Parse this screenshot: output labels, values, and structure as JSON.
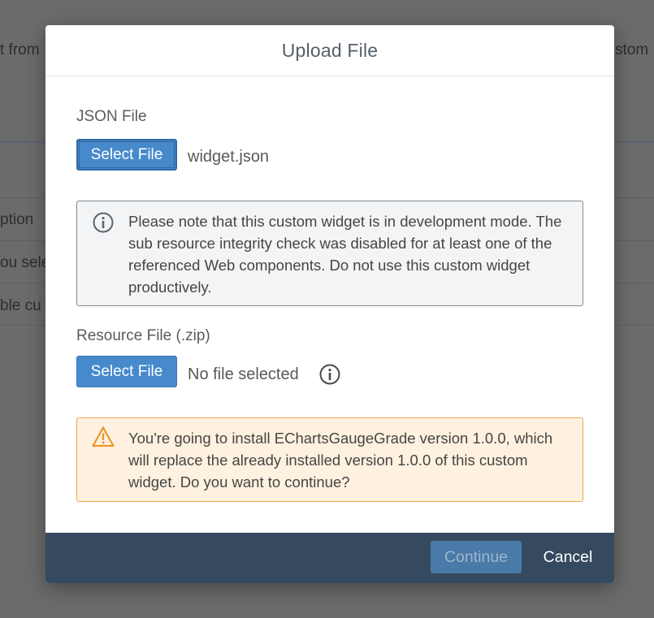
{
  "background": {
    "fragments": [
      "t from",
      "stom",
      "ption",
      "ou sele",
      "ble cu"
    ]
  },
  "dialog": {
    "title": "Upload File",
    "json_section": {
      "label": "JSON File",
      "button_label": "Select File",
      "file_name": "widget.json"
    },
    "info_message": "Please note that this custom widget is in development mode. The sub resource integrity check was disabled for at least one of the referenced Web components. Do not use this custom widget productively.",
    "resource_section": {
      "label": "Resource File (.zip)",
      "button_label": "Select File",
      "file_name": "No file selected"
    },
    "warning_message": "You're going to install EChartsGaugeGrade version 1.0.0, which will replace the already installed version 1.0.0 of this custom widget. Do you want to continue?",
    "footer": {
      "continue_label": "Continue",
      "cancel_label": "Cancel"
    }
  },
  "icons": {
    "info": "info-circle-icon",
    "warning": "warning-triangle-icon"
  },
  "colors": {
    "primary": "#468acc",
    "footer": "#354a5f",
    "warning_border": "#e9a84e",
    "warning_bg": "#fef1df",
    "info_border": "#7f8a95",
    "info_bg": "#f3f4f6"
  }
}
